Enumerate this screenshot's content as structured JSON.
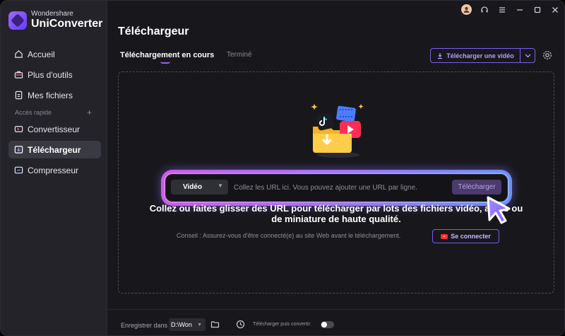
{
  "brand": {
    "small": "Wondershare",
    "name": "UniConverter"
  },
  "sidebar": {
    "items": [
      {
        "label": "Accueil",
        "icon": "home-icon"
      },
      {
        "label": "Plus d'outils",
        "icon": "toolbox-icon"
      },
      {
        "label": "Mes fichiers",
        "icon": "files-icon"
      }
    ],
    "section_label": "Accès rapide",
    "add_label": "+",
    "quick_items": [
      {
        "label": "Convertisseur",
        "icon": "convert-icon"
      },
      {
        "label": "Téléchargeur",
        "icon": "download-icon",
        "active": true
      },
      {
        "label": "Compresseur",
        "icon": "compress-icon"
      }
    ]
  },
  "header": {
    "title": "Téléchargeur"
  },
  "tabs": {
    "active": "Téléchargement en cours",
    "done": "Terminé"
  },
  "toolbar": {
    "download_video": "Télécharger une vidéo"
  },
  "urlbar": {
    "type_value": "Vidéo",
    "placeholder": "Collez les URL ici. Vous pouvez ajouter une URL par ligne.",
    "button": "Télécharger"
  },
  "main": {
    "heading_line1": "Collez ou faites glisser des URL pour télécharger par lots des fichiers vidéo, audio ou",
    "heading_line2": "de miniature de haute qualité.",
    "tip": "Conseil : Assurez-vous d'être connecté(e) au site Web avant le téléchargement.",
    "connect": "Se connecter"
  },
  "footer": {
    "save_label": "Enregistrer dans",
    "path": "D:\\Won",
    "convert_label": "Télécharger puis convertir:",
    "convert_enabled": false
  },
  "colors": {
    "accent": "#8f62ff",
    "background": "#18181c",
    "sidebar": "#232329"
  }
}
